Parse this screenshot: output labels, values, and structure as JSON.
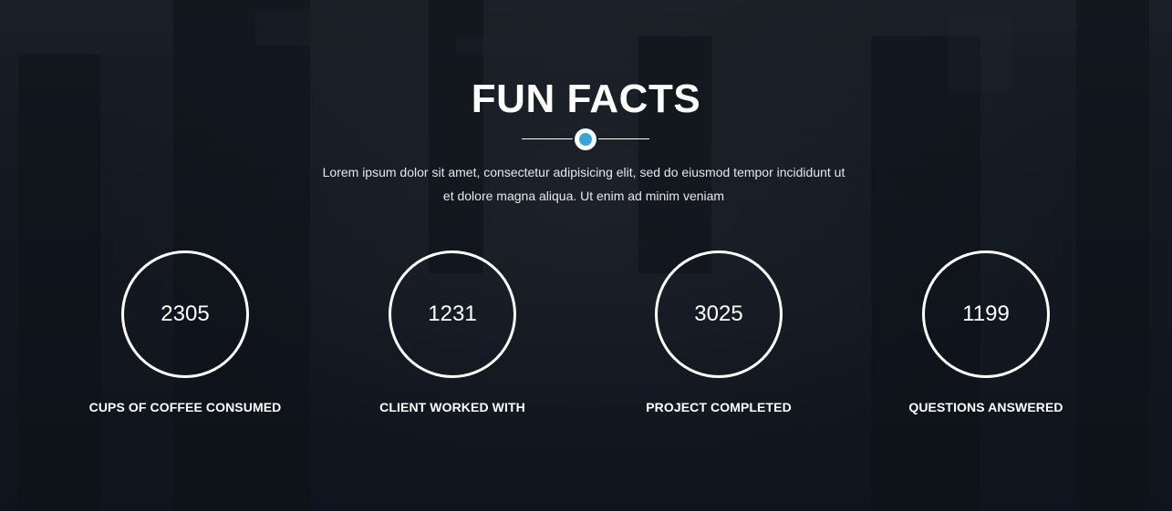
{
  "section": {
    "title": "FUN FACTS",
    "intro_line1": "Lorem ipsum dolor sit amet, consectetur adipisicing elit, sed do eiusmod tempor incididunt ut",
    "intro_line2": "et dolore magna aliqua. Ut enim ad minim veniam",
    "accent_color": "#3aa6d8"
  },
  "facts": [
    {
      "value": "2305",
      "label": "CUPS OF COFFEE CONSUMED"
    },
    {
      "value": "1231",
      "label": "CLIENT WORKED WITH"
    },
    {
      "value": "3025",
      "label": "PROJECT COMPLETED"
    },
    {
      "value": "1199",
      "label": "QUESTIONS ANSWERED"
    }
  ]
}
